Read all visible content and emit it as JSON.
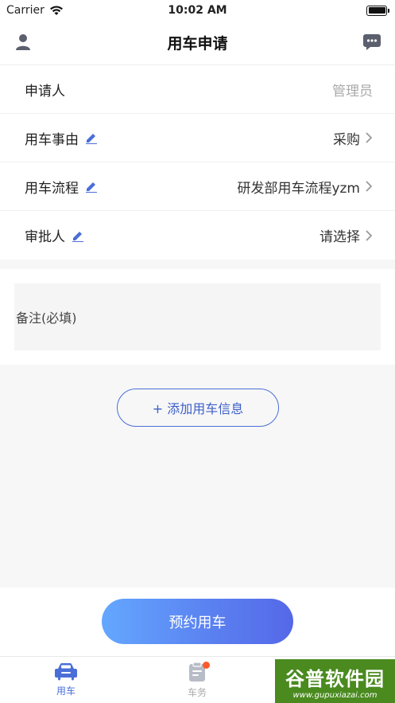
{
  "status_bar": {
    "carrier": "Carrier",
    "time": "10:02 AM"
  },
  "nav": {
    "title": "用车申请",
    "left_icon": "user-icon",
    "right_icon": "message-icon"
  },
  "form": {
    "applicant": {
      "label": "申请人",
      "value": "管理员"
    },
    "reason": {
      "label": "用车事由",
      "value": "采购"
    },
    "process": {
      "label": "用车流程",
      "value": "研发部用车流程yzm"
    },
    "approver": {
      "label": "审批人",
      "value": "请选择"
    }
  },
  "remark": {
    "placeholder": "备注(必填)"
  },
  "add_vehicle": {
    "label": "+ 添加用车信息"
  },
  "reserve": {
    "label": "预约用车"
  },
  "tabs": [
    {
      "label": "用车",
      "icon": "car-icon",
      "active": true
    },
    {
      "label": "车务",
      "icon": "clipboard-icon",
      "active": false,
      "badge": true
    }
  ],
  "watermark": {
    "main": "谷普软件园",
    "sub": "www.gupuxiazai.com"
  },
  "colors": {
    "accent": "#4a6ed8",
    "badge": "#ff5a2a",
    "edit_icon": "#4a6ed8"
  }
}
